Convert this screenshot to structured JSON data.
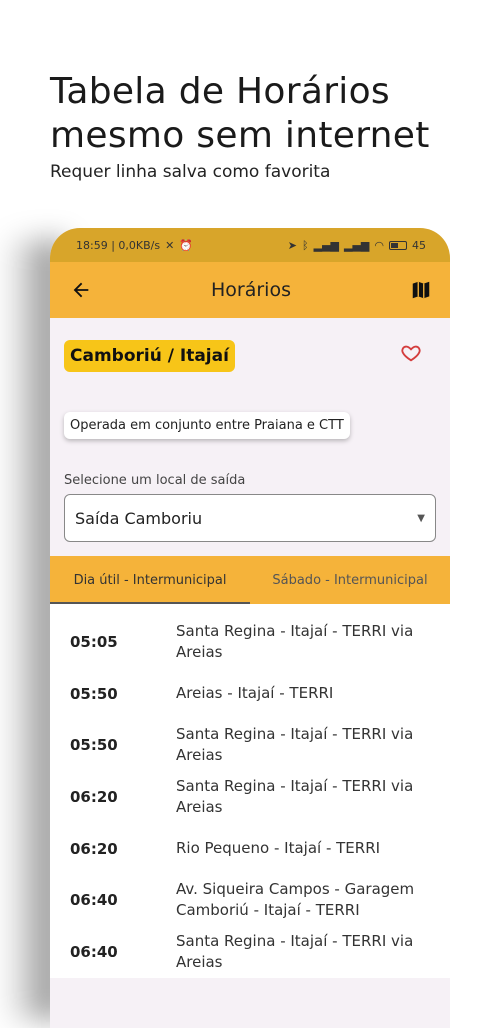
{
  "promo": {
    "title_line1": "Tabela de Horários",
    "title_line2": "mesmo sem internet",
    "subtitle": "Requer linha salva como favorita"
  },
  "statusbar": {
    "left": "18:59 | 0,0KB/s",
    "battery": "45"
  },
  "appbar": {
    "title": "Horários",
    "back_icon": "arrow-left-icon",
    "map_icon": "map-icon"
  },
  "line": {
    "name": "Camboriú / Itajaí",
    "favorite_icon": "heart-outline-icon"
  },
  "operator_note": "Operada em conjunto entre Praiana e CTT",
  "departure": {
    "label": "Selecione um local de saída",
    "selected": "Saída Camboriu"
  },
  "tabs": [
    {
      "label": "Dia útil - Intermunicipal",
      "active": true
    },
    {
      "label": "Sábado - Intermunicipal",
      "active": false
    }
  ],
  "schedule": [
    {
      "time": "05:05",
      "destination": "Santa Regina - Itajaí - TERRI via Areias"
    },
    {
      "time": "05:50",
      "destination": "Areias - Itajaí - TERRI"
    },
    {
      "time": "05:50",
      "destination": "Santa Regina - Itajaí - TERRI via Areias"
    },
    {
      "time": "06:20",
      "destination": "Santa Regina - Itajaí - TERRI via Areias"
    },
    {
      "time": "06:20",
      "destination": "Rio Pequeno - Itajaí - TERRI"
    },
    {
      "time": "06:40",
      "destination": "Av. Siqueira Campos - Garagem Camboriú - Itajaí - TERRI"
    },
    {
      "time": "06:40",
      "destination": "Santa Regina - Itajaí - TERRI via Areias"
    }
  ],
  "colors": {
    "appbar": "#f5b33a",
    "statusbar": "#d8a52a",
    "badge": "#f7c518",
    "heart": "#d43d3d"
  }
}
